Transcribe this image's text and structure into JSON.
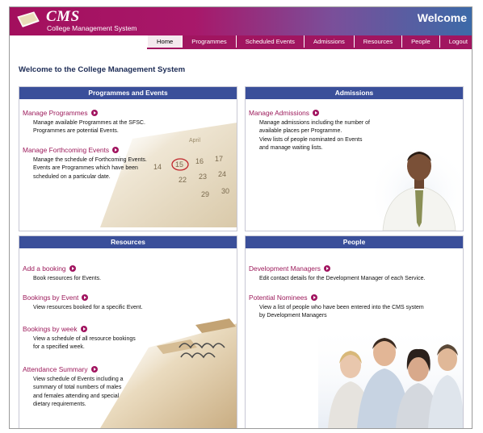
{
  "header": {
    "brand": "CMS",
    "subtitle": "College Management System",
    "welcome": "Welcome"
  },
  "nav": [
    {
      "label": "Home",
      "active": true
    },
    {
      "label": "Programmes",
      "active": false
    },
    {
      "label": "Scheduled Events",
      "active": false
    },
    {
      "label": "Admissions",
      "active": false
    },
    {
      "label": "Resources",
      "active": false
    },
    {
      "label": "People",
      "active": false
    },
    {
      "label": "Logout",
      "active": false
    }
  ],
  "page_title": "Welcome to the College Management System",
  "panels": {
    "programmes": {
      "title": "Programmes and Events",
      "items": [
        {
          "link": "Manage Programmes",
          "desc": "Manage available Programmes at the SFSC.\nProgrammes are potential Events."
        },
        {
          "link": "Manage Forthcoming Events",
          "desc": "Manage the schedule of Forthcoming Events.\nEvents are Programmes which have been\nscheduled on a particular date."
        }
      ]
    },
    "admissions": {
      "title": "Admissions",
      "items": [
        {
          "link": "Manage Admissions",
          "desc": "Manage admissions including the number of\navailable places per Programme.\nView lists of people nominated on Events\nand manage waiting lists."
        }
      ]
    },
    "resources": {
      "title": "Resources",
      "items": [
        {
          "link": "Add a booking",
          "desc": "Book resources for Events."
        },
        {
          "link": "Bookings by Event",
          "desc": "View resources booked for a specific Event."
        },
        {
          "link": "Bookings by week",
          "desc": "View a schedule of all resource bookings\nfor a specified week."
        },
        {
          "link": "Attendance Summary",
          "desc": "View schedule of Events including a\nsummary of total numbers of males\nand females attending and special\ndietary requirements."
        }
      ]
    },
    "people": {
      "title": "People",
      "items": [
        {
          "link": "Development Managers",
          "desc": "Edit contact details for the Development Manager of each Service."
        },
        {
          "link": "Potential Nominees",
          "desc": "View a list of people who have been entered into the CMS system\nby Development Managers"
        }
      ]
    }
  },
  "calendar_digits": [
    "14",
    "15",
    "16",
    "17",
    "22",
    "23",
    "24",
    "29",
    "30"
  ],
  "colors": {
    "brand": "#a11560",
    "panel_header": "#3a4f9a",
    "link": "#9c1b5b",
    "title": "#1c2b55"
  }
}
